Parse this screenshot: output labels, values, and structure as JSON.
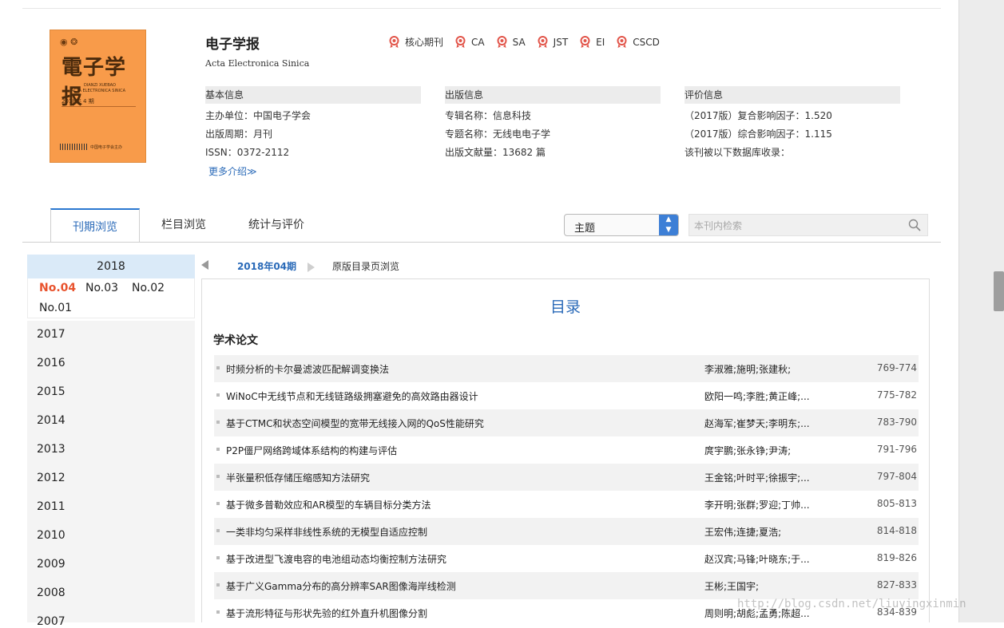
{
  "journal": {
    "cover_title": "電子学报",
    "cover_logos": "◉ ❂",
    "cover_pinyin": "DIANZI XUEBAO",
    "cover_english": "ACTA ELECTRONICA SINICA",
    "cover_issue": "2018年 4 期",
    "cover_publisher": "中国电子学会主办",
    "title": "电子学报",
    "english_title": "Acta Electronica Sinica",
    "badges": [
      "核心期刊",
      "CA",
      "SA",
      "JST",
      "EI",
      "CSCD"
    ]
  },
  "basic_info": {
    "heading": "基本信息",
    "lines": [
      "主办单位：中国电子学会",
      "出版周期：月刊",
      "ISSN：0372-2112"
    ],
    "more_label": "更多介绍≫"
  },
  "publish_info": {
    "heading": "出版信息",
    "lines": [
      "专辑名称：信息科技",
      "专题名称：无线电电子学",
      "出版文献量：13682 篇"
    ]
  },
  "eval_info": {
    "heading": "评价信息",
    "lines": [
      "（2017版）复合影响因子：1.520",
      "（2017版）综合影响因子：1.115",
      "该刊被以下数据库收录："
    ]
  },
  "tabs": [
    "刊期浏览",
    "栏目浏览",
    "统计与评价"
  ],
  "search": {
    "field_value": "主题",
    "placeholder": "本刊内检索"
  },
  "years": {
    "current": "2018",
    "issues": [
      "No.04",
      "No.03",
      "No.02",
      "No.01"
    ],
    "list": [
      "2017",
      "2016",
      "2015",
      "2014",
      "2013",
      "2012",
      "2011",
      "2010",
      "2009",
      "2008",
      "2007"
    ]
  },
  "toc": {
    "issue_tab": "2018年04期",
    "original_link": "原版目录页浏览",
    "title": "目录",
    "section": "学术论文",
    "rows": [
      {
        "title": "时频分析的卡尔曼滤波匹配解调变换法",
        "authors": "李淑雅;施明;张建秋;",
        "pages": "769-774"
      },
      {
        "title": "WiNoC中无线节点和无线链路级拥塞避免的高效路由器设计",
        "authors": "欧阳一鸣;李胜;黄正峰;...",
        "pages": "775-782"
      },
      {
        "title": "基于CTMC和状态空间模型的宽带无线接入网的QoS性能研究",
        "authors": "赵海军;崔梦天;李明东;...",
        "pages": "783-790"
      },
      {
        "title": "P2P僵尸网络跨域体系结构的构建与评估",
        "authors": "庹宇鹏;张永铮;尹涛;",
        "pages": "791-796"
      },
      {
        "title": "半张量积低存储压缩感知方法研究",
        "authors": "王金铭;叶时平;徐振宇;...",
        "pages": "797-804"
      },
      {
        "title": "基于微多普勒效应和AR模型的车辆目标分类方法",
        "authors": "李开明;张群;罗迎;丁帅...",
        "pages": "805-813"
      },
      {
        "title": "一类非均匀采样非线性系统的无模型自适应控制",
        "authors": "王宏伟;连捷;夏浩;",
        "pages": "814-818"
      },
      {
        "title": "基于改进型飞渡电容的电池组动态均衡控制方法研究",
        "authors": "赵汉宾;马锋;叶晓东;于...",
        "pages": "819-826"
      },
      {
        "title": "基于广义Gamma分布的高分辨率SAR图像海岸线检测",
        "authors": "王彬;王国宇;",
        "pages": "827-833"
      },
      {
        "title": "基于流形特征与形状先验的红外直升机图像分割",
        "authors": "周则明;胡彪;孟勇;陈超...",
        "pages": "834-839"
      }
    ]
  },
  "watermark": "http://blog.csdn.net/liuyingxinmin",
  "colors": {
    "accent": "#2a6ab8",
    "selected_issue": "#e8532e",
    "cover": "#f89b4a",
    "badge": "#e2554a"
  }
}
